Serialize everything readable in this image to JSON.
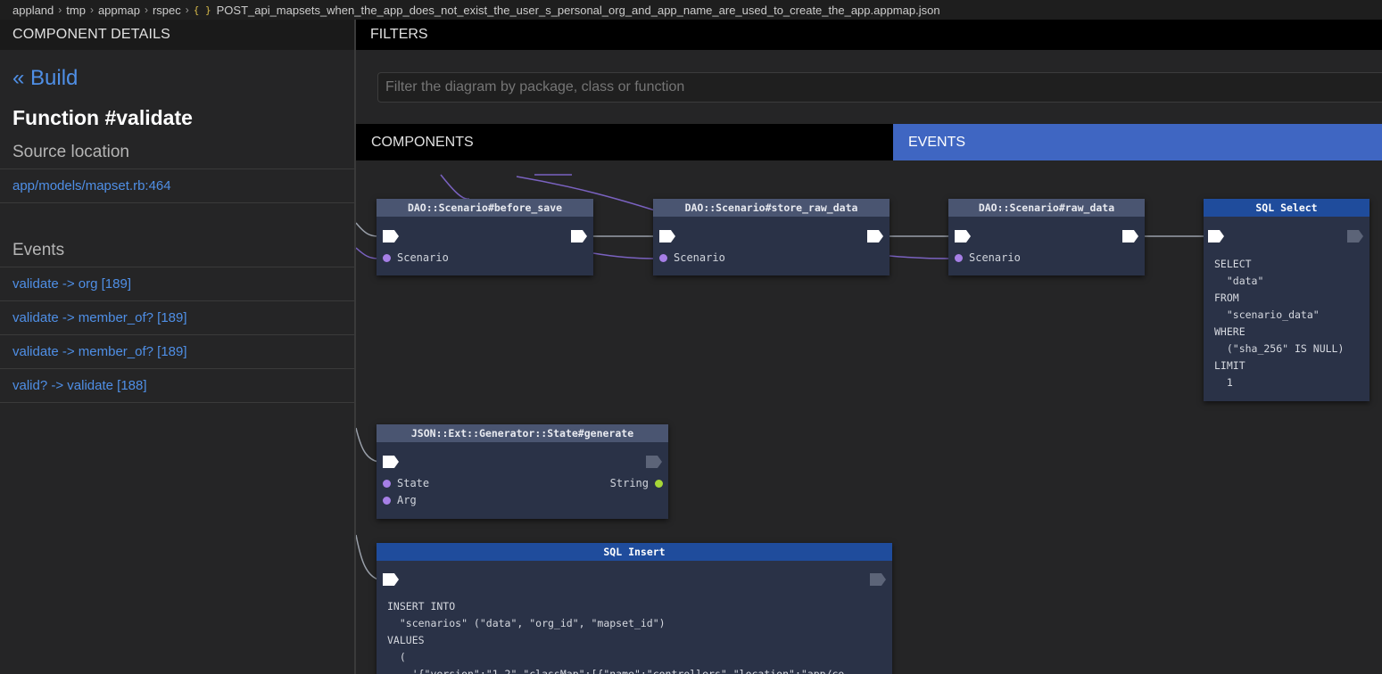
{
  "breadcrumb": {
    "items": [
      "appland",
      "tmp",
      "appmap",
      "rspec"
    ],
    "file_icon": "{ }",
    "file": "POST_api_mapsets_when_the_app_does_not_exist_the_user_s_personal_org_and_app_name_are_used_to_create_the_app.appmap.json"
  },
  "details": {
    "header": "COMPONENT DETAILS",
    "back": "« Build",
    "title": "Function #validate",
    "source_label": "Source location",
    "source_value": "app/models/mapset.rb:464",
    "events_label": "Events",
    "events": [
      "validate -> org [189]",
      "validate -> member_of? [189]",
      "validate -> member_of? [189]",
      "valid? -> validate [188]"
    ]
  },
  "filters": {
    "header": "FILTERS",
    "placeholder": "Filter the diagram by package, class or function"
  },
  "tabs": {
    "components": "COMPONENTS",
    "events": "EVENTS"
  },
  "nodes": {
    "before_save": {
      "title": "DAO::Scenario#before_save",
      "param": "Scenario"
    },
    "store_raw_data": {
      "title": "DAO::Scenario#store_raw_data",
      "param": "Scenario"
    },
    "raw_data": {
      "title": "DAO::Scenario#raw_data",
      "param": "Scenario"
    },
    "sql_select": {
      "title": "SQL Select",
      "sql": [
        "SELECT",
        "  \"data\"",
        "FROM",
        "  \"scenario_data\"",
        "WHERE",
        "  (\"sha_256\" IS NULL)",
        "LIMIT",
        "  1"
      ]
    },
    "generate": {
      "title": "JSON::Ext::Generator::State#generate",
      "param1": "State",
      "param2": "Arg",
      "return": "String"
    },
    "sql_insert": {
      "title": "SQL Insert",
      "sql": [
        "INSERT INTO",
        "  \"scenarios\" (\"data\", \"org_id\", \"mapset_id\")",
        "VALUES",
        "  (",
        "    '{\"version\":\"1.2\",\"classMap\":[{\"name\":\"controllers\",\"location\":\"app/co"
      ]
    }
  },
  "colors": {
    "accent": "#3f66c2",
    "link": "#4f8fe6",
    "node": "#2a3247",
    "sql_header": "#1f4c9c"
  }
}
